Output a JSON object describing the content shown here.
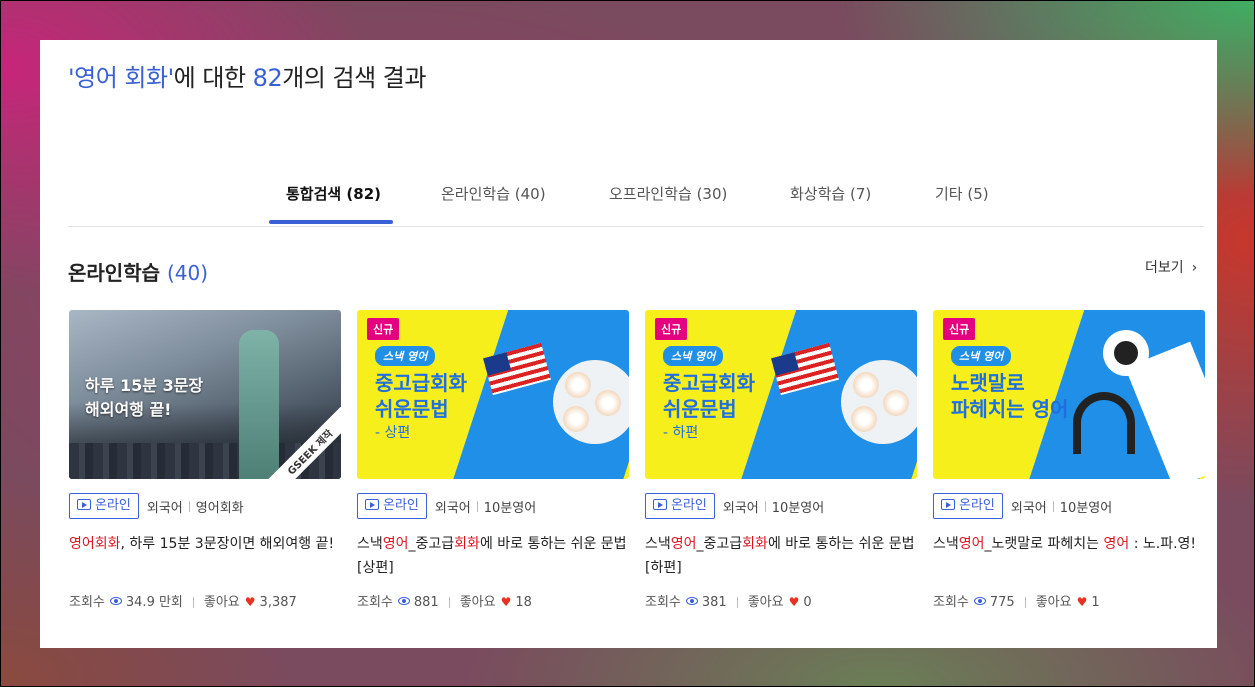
{
  "header": {
    "quote_open": "'",
    "query": "영어 회화",
    "quote_close": "'",
    "text_mid": "에 대한 ",
    "count": "82",
    "text_end": "개의 검색 결과"
  },
  "tabs": [
    {
      "label": "통합검색 (82)",
      "active": true
    },
    {
      "label": "온라인학습 (40)",
      "active": false
    },
    {
      "label": "오프라인학습 (30)",
      "active": false
    },
    {
      "label": "화상학습 (7)",
      "active": false
    },
    {
      "label": "기타 (5)",
      "active": false
    }
  ],
  "section": {
    "title": "온라인학습 ",
    "count": "(40)",
    "more_label": "더보기",
    "more_icon": "chevron-right-icon"
  },
  "cards": [
    {
      "thumb_lines": [
        "하루 15분 3문장",
        "해외여행 끝!"
      ],
      "corner_tag": "GSEEK 제작",
      "chip": "온라인",
      "cat1": "외국어",
      "cat2": "영어회화",
      "title_parts": [
        {
          "t": "영어회화",
          "red": true
        },
        {
          "t": ", 하루 15분 3문장이면 해외여행 끝!",
          "red": false
        }
      ],
      "views_label": "조회수",
      "views": "34.9 만회",
      "likes_label": "좋아요",
      "likes": "3,387"
    },
    {
      "badge": "신규",
      "brand": "스낵 영어",
      "thumb_lines": [
        "중고급회화",
        "쉬운문법"
      ],
      "thumb_sub": "- 상편",
      "chip": "온라인",
      "cat1": "외국어",
      "cat2": "10분영어",
      "title_parts": [
        {
          "t": "스낵",
          "red": false
        },
        {
          "t": "영어",
          "red": true
        },
        {
          "t": "_중고급",
          "red": false
        },
        {
          "t": "회화",
          "red": true
        },
        {
          "t": "에 바로 통하는 쉬운 문법 [상편]",
          "red": false
        }
      ],
      "views_label": "조회수",
      "views": "881",
      "likes_label": "좋아요",
      "likes": "18"
    },
    {
      "badge": "신규",
      "brand": "스낵 영어",
      "thumb_lines": [
        "중고급회화",
        "쉬운문법"
      ],
      "thumb_sub": "- 하편",
      "chip": "온라인",
      "cat1": "외국어",
      "cat2": "10분영어",
      "title_parts": [
        {
          "t": "스낵",
          "red": false
        },
        {
          "t": "영어",
          "red": true
        },
        {
          "t": "_중고급",
          "red": false
        },
        {
          "t": "회화",
          "red": true
        },
        {
          "t": "에 바로 통하는 쉬운 문법 [하편]",
          "red": false
        }
      ],
      "views_label": "조회수",
      "views": "381",
      "likes_label": "좋아요",
      "likes": "0"
    },
    {
      "badge": "신규",
      "brand": "스낵 영어",
      "thumb_lines": [
        "노랫말로",
        "파헤치는 영어"
      ],
      "chip": "온라인",
      "cat1": "외국어",
      "cat2": "10분영어",
      "title_parts": [
        {
          "t": "스낵",
          "red": false
        },
        {
          "t": "영어",
          "red": true
        },
        {
          "t": "_노랫말로 파헤치는 ",
          "red": false
        },
        {
          "t": "영어",
          "red": true
        },
        {
          "t": " : 노.파.영!",
          "red": false
        }
      ],
      "views_label": "조회수",
      "views": "775",
      "likes_label": "좋아요",
      "likes": "1"
    }
  ],
  "colors": {
    "accent": "#3a60d6",
    "highlight": "#d9151f",
    "heart": "#e8321f",
    "badge": "#e5007f",
    "thumb_yellow": "#f7ef1b",
    "thumb_blue": "#1f8fe8"
  }
}
